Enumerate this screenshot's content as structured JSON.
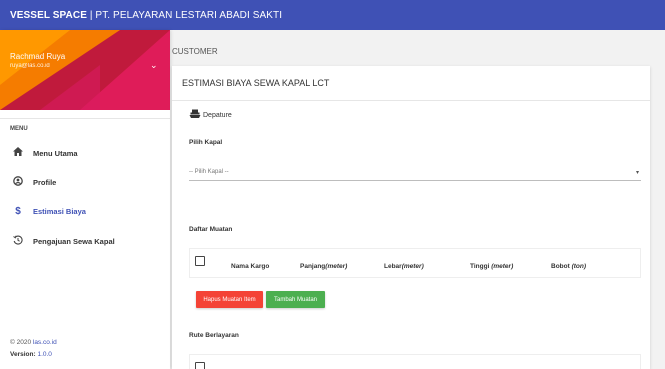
{
  "header": {
    "brand": "VESSEL SPACE",
    "company": "| PT. PELAYARAN LESTARI ABADI SAKTI",
    "bg_color": "#3f51b5"
  },
  "user": {
    "name": "Rachmad Ruya",
    "email": "ruya@las.co.id"
  },
  "menu": {
    "heading": "MENU",
    "items": [
      {
        "label": "Menu Utama",
        "icon": "home-icon"
      },
      {
        "label": "Profile",
        "icon": "account-icon"
      },
      {
        "label": "Estimasi Biaya",
        "icon": "dollar-icon",
        "active": true
      },
      {
        "label": "Pengajuan Sewa Kapal",
        "icon": "history-icon"
      }
    ]
  },
  "footer": {
    "copyright_prefix": "© 2020",
    "copyright_link": "las.co.id",
    "version_label": "Version:",
    "version": "1.0.0"
  },
  "breadcrumb": "CUSTOMER",
  "card": {
    "title": "ESTIMASI BIAYA SEWA KAPAL LCT",
    "section_label": "Depature",
    "pilih_kapal_label": "Pilih Kapal",
    "pilih_kapal_value": "-- Pilih Kapal --",
    "daftar_muatan_label": "Daftar Muatan",
    "columns": [
      {
        "name": "Nama Kargo",
        "unit": ""
      },
      {
        "name": "Panjang",
        "unit": "(meter)"
      },
      {
        "name": "Lebar",
        "unit": "(meter)"
      },
      {
        "name": "Tinggi",
        "unit": "(meter)"
      },
      {
        "name": "Bobot",
        "unit": "(ton)"
      }
    ],
    "btn_hapus": "Hapus Muatan Item",
    "btn_tambah": "Tambah Muatan",
    "rute_label": "Rute Berlayaran"
  },
  "colors": {
    "accent": "#3f51b5",
    "danger": "#f44336",
    "success": "#4caf50"
  }
}
